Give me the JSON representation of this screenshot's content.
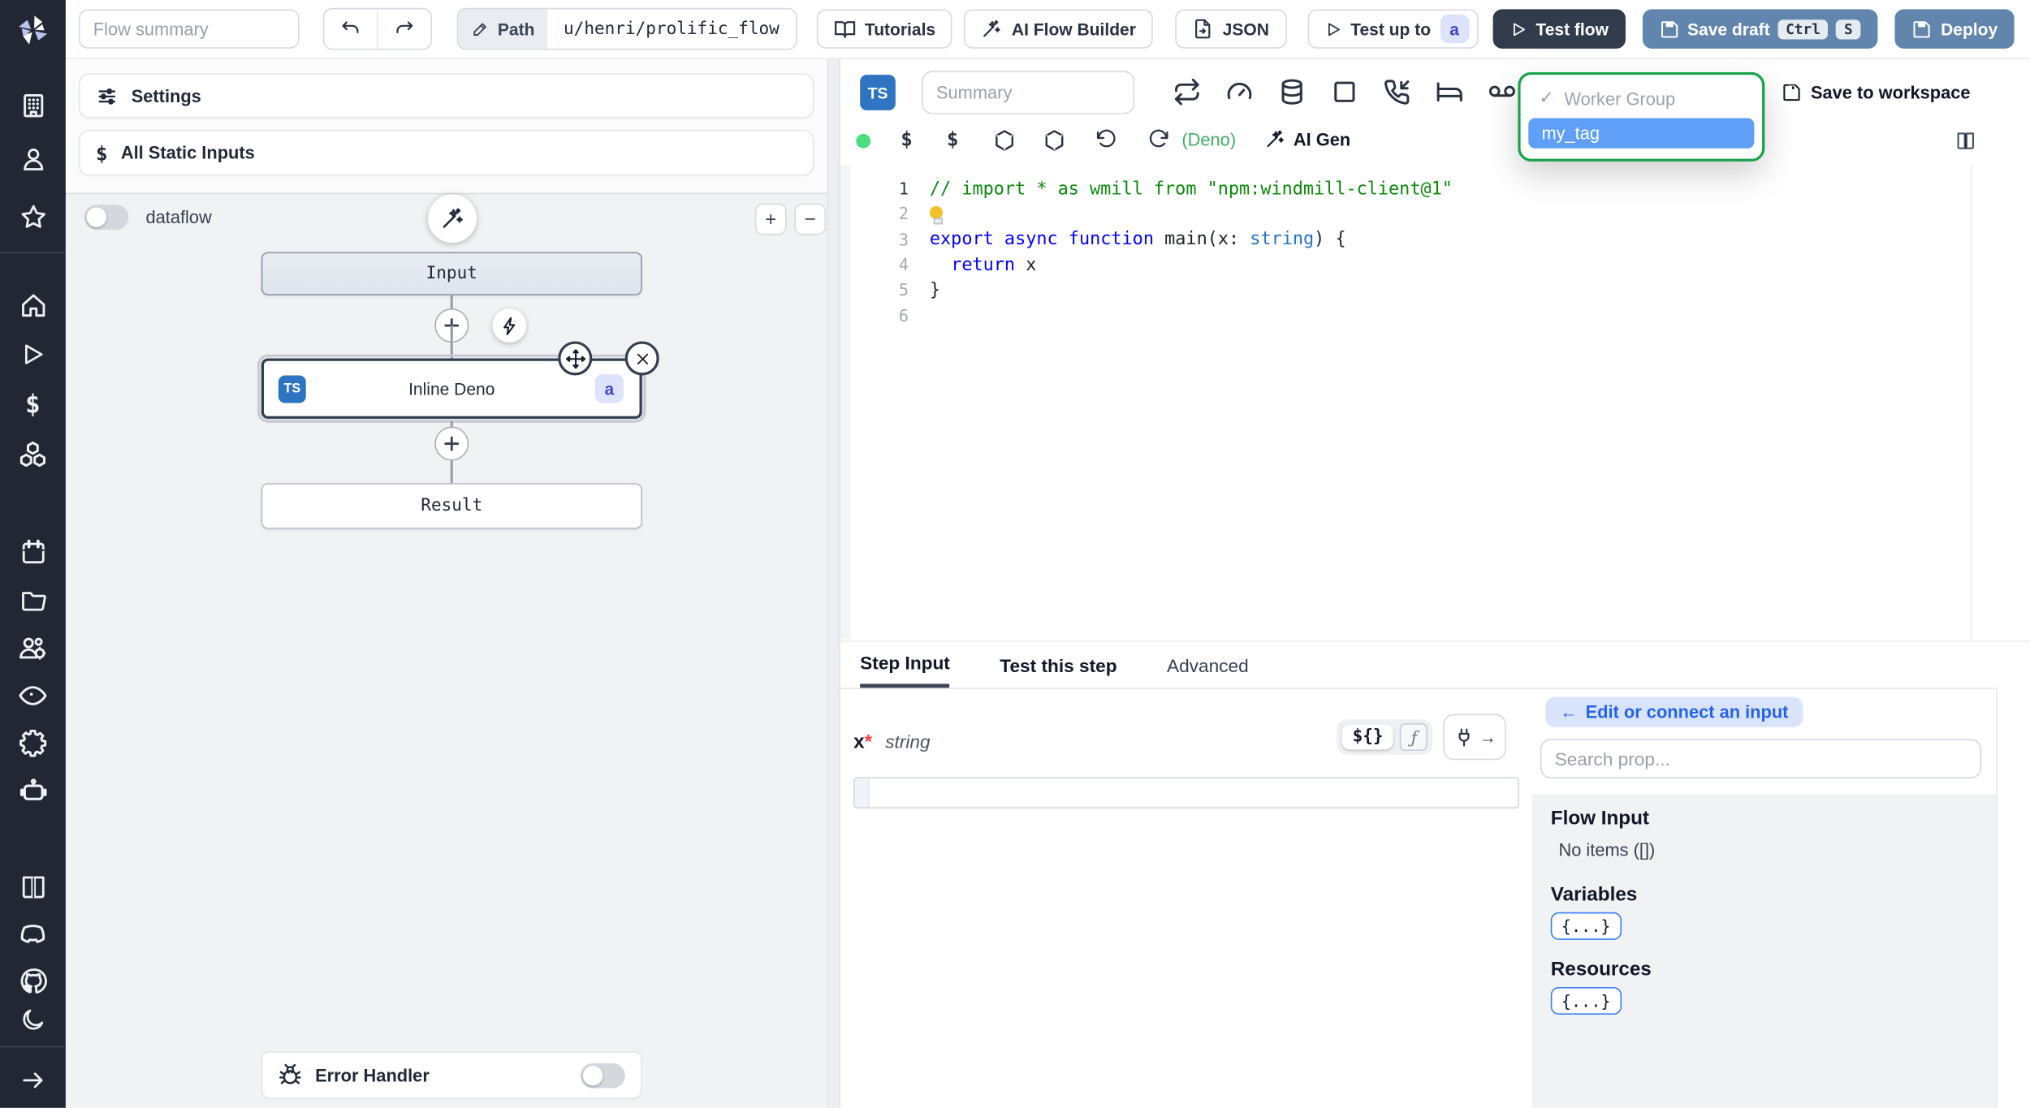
{
  "topbar": {
    "flow_summary_placeholder": "Flow summary",
    "path_label": "Path",
    "path_value": "u/henri/prolific_flow",
    "tutorials_label": "Tutorials",
    "ai_flow_builder_label": "AI Flow Builder",
    "json_label": "JSON",
    "test_up_to_label": "Test up to",
    "test_up_to_step": "a",
    "test_flow_label": "Test flow",
    "save_draft_label": "Save draft",
    "save_draft_kbd": [
      "Ctrl",
      "S"
    ],
    "deploy_label": "Deploy"
  },
  "flow_panel": {
    "settings_label": "Settings",
    "all_static_inputs_label": "All Static Inputs",
    "dataflow_label": "dataflow",
    "zoom_in": "+",
    "zoom_out": "−",
    "graph": {
      "input_node": "Input",
      "step_node": {
        "lang_badge": "TS",
        "title": "Inline Deno",
        "id_badge": "a"
      },
      "result_node": "Result"
    },
    "error_handler_label": "Error Handler"
  },
  "editor": {
    "lang_badge": "TS",
    "summary_placeholder": "Summary",
    "save_to_workspace_label": "Save to workspace",
    "worker_group_dropdown": {
      "check": "✓",
      "group_label": "Worker Group",
      "selected_tag": "my_tag"
    },
    "dollar_1": "$",
    "dollar_2": "$",
    "lang_indicator": "(Deno)",
    "ai_gen_label": "AI Gen",
    "code_lines": [
      {
        "num": "1",
        "tokens": [
          [
            "comment",
            "// import * as wmill from \"npm:windmill-client@1\""
          ]
        ]
      },
      {
        "num": "2",
        "tokens": [
          [
            "bulb",
            ""
          ]
        ]
      },
      {
        "num": "3",
        "tokens": [
          [
            "kw",
            "export"
          ],
          [
            "pl",
            " "
          ],
          [
            "kw",
            "async"
          ],
          [
            "pl",
            " "
          ],
          [
            "kw",
            "function"
          ],
          [
            "pl",
            " "
          ],
          [
            "fn",
            "main"
          ],
          [
            "pl",
            "(x: "
          ],
          [
            "ty",
            "string"
          ],
          [
            "pl",
            ") {"
          ]
        ]
      },
      {
        "num": "4",
        "tokens": [
          [
            "pl",
            "  "
          ],
          [
            "kw",
            "return"
          ],
          [
            "pl",
            " x"
          ]
        ]
      },
      {
        "num": "5",
        "tokens": [
          [
            "pl",
            "}"
          ]
        ]
      },
      {
        "num": "6",
        "tokens": []
      }
    ]
  },
  "step_panel": {
    "tabs": [
      "Step Input",
      "Test this step",
      "Advanced"
    ],
    "arg": {
      "name": "x",
      "required_mark": "*",
      "type": "string"
    },
    "expr_toggle": "${}",
    "fn_toggle": "ƒ",
    "connect": {
      "edit_or_connect_label": "Edit or connect an input",
      "arrow": "←",
      "search_placeholder": "Search prop...",
      "flow_input_label": "Flow Input",
      "no_items_label": "No items ([])",
      "variables_label": "Variables",
      "resources_label": "Resources",
      "object_chip": "{...}"
    }
  }
}
